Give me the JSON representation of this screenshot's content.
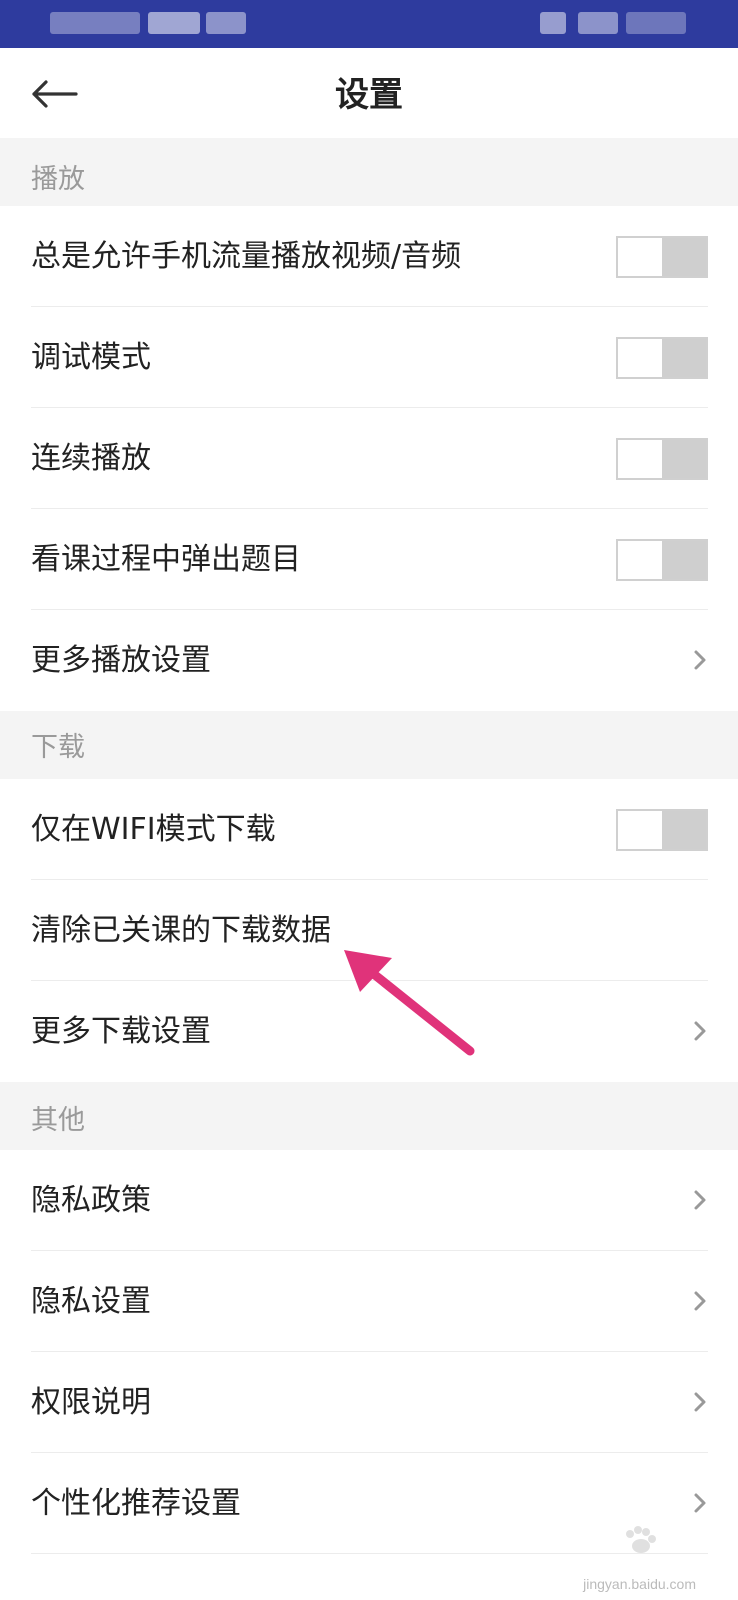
{
  "status_bar": {
    "color": "#2e3b9e"
  },
  "header": {
    "title": "设置",
    "back_icon": "arrow-left-icon"
  },
  "sections": {
    "playback": {
      "title": "播放",
      "items": [
        {
          "label": "总是允许手机流量播放视频/音频",
          "type": "toggle",
          "on": false
        },
        {
          "label": "调试模式",
          "type": "toggle",
          "on": false
        },
        {
          "label": "连续播放",
          "type": "toggle",
          "on": false
        },
        {
          "label": "看课过程中弹出题目",
          "type": "toggle",
          "on": false
        },
        {
          "label": "更多播放设置",
          "type": "link"
        }
      ]
    },
    "download": {
      "title": "下载",
      "items": [
        {
          "label": "仅在WIFI模式下载",
          "type": "toggle",
          "on": false
        },
        {
          "label": "清除已关课的下载数据",
          "type": "action"
        },
        {
          "label": "更多下载设置",
          "type": "link"
        }
      ]
    },
    "other": {
      "title": "其他",
      "items": [
        {
          "label": "隐私政策",
          "type": "link"
        },
        {
          "label": "隐私设置",
          "type": "link"
        },
        {
          "label": "权限说明",
          "type": "link"
        },
        {
          "label": "个性化推荐设置",
          "type": "link"
        }
      ]
    }
  },
  "annotation": {
    "arrow_color": "#e0337a"
  },
  "watermark": {
    "text": "jingyan.baidu.com"
  }
}
